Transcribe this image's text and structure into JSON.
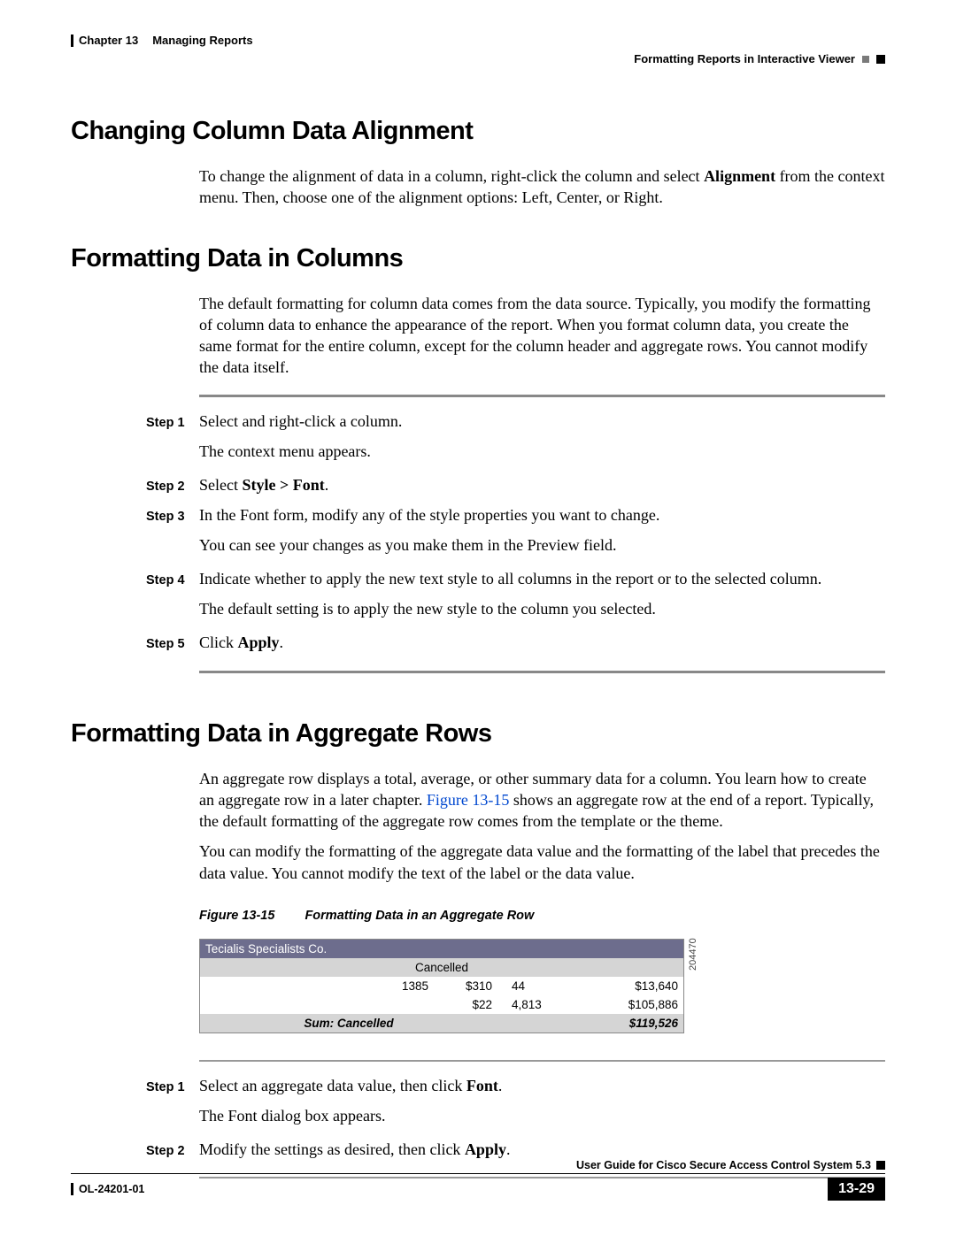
{
  "header": {
    "chapter": "Chapter 13",
    "chapter_title": "Managing Reports",
    "section_right": "Formatting Reports in Interactive Viewer"
  },
  "sections": {
    "alignment": {
      "heading": "Changing Column Data Alignment",
      "p1_a": "To change the alignment of data in a column, right-click the column and select ",
      "p1_bold": "Alignment",
      "p1_b": " from the context menu. Then, choose one of the alignment options: Left, Center, or Right."
    },
    "columns": {
      "heading": "Formatting Data in Columns",
      "intro": "The default formatting for column data comes from the data source. Typically, you modify the formatting of column data to enhance the appearance of the report. When you format column data, you create the same format for the entire column, except for the column header and aggregate rows. You cannot modify the data itself.",
      "steps": [
        {
          "label": "Step 1",
          "text": "Select and right-click a column.",
          "sub": "The context menu appears."
        },
        {
          "label": "Step 2",
          "text_a": "Select ",
          "text_bold": "Style > Font",
          "text_b": "."
        },
        {
          "label": "Step 3",
          "text": "In the Font form, modify any of the style properties you want to change.",
          "sub": "You can see your changes as you make them in the Preview field."
        },
        {
          "label": "Step 4",
          "text": "Indicate whether to apply the new text style to all columns in the report or to the selected column.",
          "sub": "The default setting is to apply the new style to the column you selected."
        },
        {
          "label": "Step 5",
          "text_a": "Click ",
          "text_bold": "Apply",
          "text_b": "."
        }
      ]
    },
    "aggregate": {
      "heading": "Formatting Data in Aggregate Rows",
      "p1_a": "An aggregate row displays a total, average, or other summary data for a column. You learn how to create an aggregate row in a later chapter. ",
      "p1_link": "Figure 13-15",
      "p1_b": " shows an aggregate row at the end of a report. Typically, the default formatting of the aggregate row comes from the template or the theme.",
      "p2": "You can modify the formatting of the aggregate data value and the formatting of the label that precedes the data value. You cannot modify the text of the label or the data value.",
      "figure": {
        "num": "Figure 13-15",
        "title": "Formatting Data in an Aggregate Row",
        "header1": "Tecialis Specialists Co.",
        "header2": "Cancelled",
        "rows": [
          {
            "c1": "",
            "c2": "1385",
            "c3": "$310",
            "c4": "44",
            "c5": "$13,640"
          },
          {
            "c1": "",
            "c2": "",
            "c3": "$22",
            "c4": "4,813",
            "c5": "$105,886"
          }
        ],
        "sum_label": "Sum:  Cancelled",
        "sum_value": "$119,526",
        "sidecode": "204470"
      },
      "steps": [
        {
          "label": "Step 1",
          "text_a": "Select an aggregate data value, then click ",
          "text_bold": "Font",
          "text_b": ".",
          "sub": "The Font dialog box appears."
        },
        {
          "label": "Step 2",
          "text_a": "Modify the settings as desired, then click ",
          "text_bold": "Apply",
          "text_b": "."
        }
      ]
    }
  },
  "footer": {
    "guide_title": "User Guide for Cisco Secure Access Control System 5.3",
    "doc_id": "OL-24201-01",
    "page_num": "13-29"
  }
}
